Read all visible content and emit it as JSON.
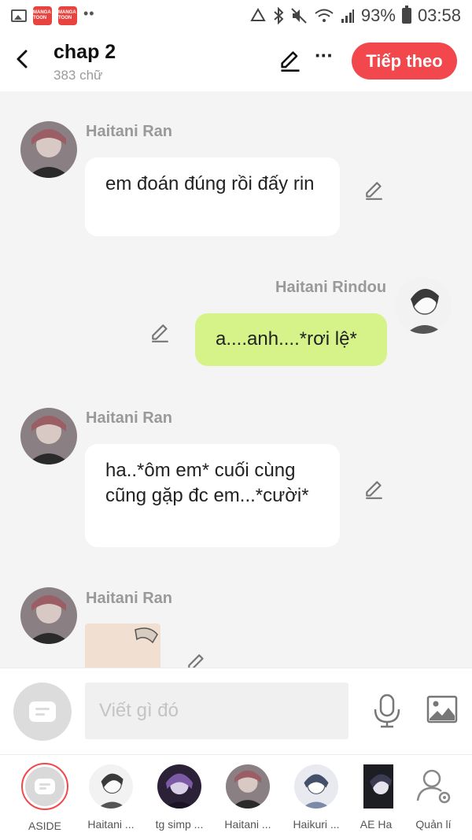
{
  "status_bar": {
    "app_badge_text": "MANGA TOON",
    "battery": "93%",
    "time": "03:58"
  },
  "header": {
    "title": "chap 2",
    "word_count": "383 chữ",
    "next_button": "Tiếp theo"
  },
  "messages": [
    {
      "sender": "Haitani Ran",
      "text": "em đoán đúng rồi đấy rin",
      "side": "left"
    },
    {
      "sender": "Haitani Rindou",
      "text": "a....anh....*rơi lệ*",
      "side": "right"
    },
    {
      "sender": "Haitani Ran",
      "text": "ha..*ôm em* cuối cùng cũng gặp đc em...*cười*",
      "side": "left"
    },
    {
      "sender": "Haitani Ran",
      "text": "",
      "side": "left",
      "type": "image"
    }
  ],
  "composer": {
    "placeholder": "Viết gì đó"
  },
  "characters": [
    {
      "label": "ASIDE"
    },
    {
      "label": "Haitani ..."
    },
    {
      "label": "tg simp ..."
    },
    {
      "label": "Haitani ..."
    },
    {
      "label": "Haikuri ..."
    },
    {
      "label": "AE Ha"
    },
    {
      "label": "Quản lí"
    }
  ],
  "colors": {
    "accent": "#f2474c",
    "right_bubble": "#d6f38a",
    "background": "#f4f4f4"
  },
  "icons": [
    "back-arrow-icon",
    "pencil-icon",
    "more-dots-icon",
    "microphone-icon",
    "image-icon",
    "chat-bubble-icon",
    "user-settings-icon"
  ]
}
